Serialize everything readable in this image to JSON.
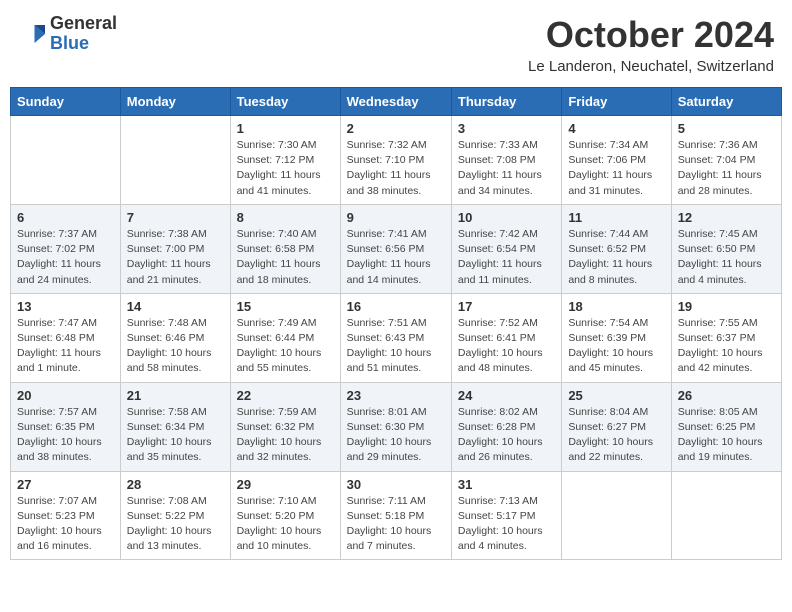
{
  "header": {
    "logo_general": "General",
    "logo_blue": "Blue",
    "month": "October 2024",
    "location": "Le Landeron, Neuchatel, Switzerland"
  },
  "days_of_week": [
    "Sunday",
    "Monday",
    "Tuesday",
    "Wednesday",
    "Thursday",
    "Friday",
    "Saturday"
  ],
  "weeks": [
    [
      {
        "day": "",
        "info": ""
      },
      {
        "day": "",
        "info": ""
      },
      {
        "day": "1",
        "info": "Sunrise: 7:30 AM\nSunset: 7:12 PM\nDaylight: 11 hours and 41 minutes."
      },
      {
        "day": "2",
        "info": "Sunrise: 7:32 AM\nSunset: 7:10 PM\nDaylight: 11 hours and 38 minutes."
      },
      {
        "day": "3",
        "info": "Sunrise: 7:33 AM\nSunset: 7:08 PM\nDaylight: 11 hours and 34 minutes."
      },
      {
        "day": "4",
        "info": "Sunrise: 7:34 AM\nSunset: 7:06 PM\nDaylight: 11 hours and 31 minutes."
      },
      {
        "day": "5",
        "info": "Sunrise: 7:36 AM\nSunset: 7:04 PM\nDaylight: 11 hours and 28 minutes."
      }
    ],
    [
      {
        "day": "6",
        "info": "Sunrise: 7:37 AM\nSunset: 7:02 PM\nDaylight: 11 hours and 24 minutes."
      },
      {
        "day": "7",
        "info": "Sunrise: 7:38 AM\nSunset: 7:00 PM\nDaylight: 11 hours and 21 minutes."
      },
      {
        "day": "8",
        "info": "Sunrise: 7:40 AM\nSunset: 6:58 PM\nDaylight: 11 hours and 18 minutes."
      },
      {
        "day": "9",
        "info": "Sunrise: 7:41 AM\nSunset: 6:56 PM\nDaylight: 11 hours and 14 minutes."
      },
      {
        "day": "10",
        "info": "Sunrise: 7:42 AM\nSunset: 6:54 PM\nDaylight: 11 hours and 11 minutes."
      },
      {
        "day": "11",
        "info": "Sunrise: 7:44 AM\nSunset: 6:52 PM\nDaylight: 11 hours and 8 minutes."
      },
      {
        "day": "12",
        "info": "Sunrise: 7:45 AM\nSunset: 6:50 PM\nDaylight: 11 hours and 4 minutes."
      }
    ],
    [
      {
        "day": "13",
        "info": "Sunrise: 7:47 AM\nSunset: 6:48 PM\nDaylight: 11 hours and 1 minute."
      },
      {
        "day": "14",
        "info": "Sunrise: 7:48 AM\nSunset: 6:46 PM\nDaylight: 10 hours and 58 minutes."
      },
      {
        "day": "15",
        "info": "Sunrise: 7:49 AM\nSunset: 6:44 PM\nDaylight: 10 hours and 55 minutes."
      },
      {
        "day": "16",
        "info": "Sunrise: 7:51 AM\nSunset: 6:43 PM\nDaylight: 10 hours and 51 minutes."
      },
      {
        "day": "17",
        "info": "Sunrise: 7:52 AM\nSunset: 6:41 PM\nDaylight: 10 hours and 48 minutes."
      },
      {
        "day": "18",
        "info": "Sunrise: 7:54 AM\nSunset: 6:39 PM\nDaylight: 10 hours and 45 minutes."
      },
      {
        "day": "19",
        "info": "Sunrise: 7:55 AM\nSunset: 6:37 PM\nDaylight: 10 hours and 42 minutes."
      }
    ],
    [
      {
        "day": "20",
        "info": "Sunrise: 7:57 AM\nSunset: 6:35 PM\nDaylight: 10 hours and 38 minutes."
      },
      {
        "day": "21",
        "info": "Sunrise: 7:58 AM\nSunset: 6:34 PM\nDaylight: 10 hours and 35 minutes."
      },
      {
        "day": "22",
        "info": "Sunrise: 7:59 AM\nSunset: 6:32 PM\nDaylight: 10 hours and 32 minutes."
      },
      {
        "day": "23",
        "info": "Sunrise: 8:01 AM\nSunset: 6:30 PM\nDaylight: 10 hours and 29 minutes."
      },
      {
        "day": "24",
        "info": "Sunrise: 8:02 AM\nSunset: 6:28 PM\nDaylight: 10 hours and 26 minutes."
      },
      {
        "day": "25",
        "info": "Sunrise: 8:04 AM\nSunset: 6:27 PM\nDaylight: 10 hours and 22 minutes."
      },
      {
        "day": "26",
        "info": "Sunrise: 8:05 AM\nSunset: 6:25 PM\nDaylight: 10 hours and 19 minutes."
      }
    ],
    [
      {
        "day": "27",
        "info": "Sunrise: 7:07 AM\nSunset: 5:23 PM\nDaylight: 10 hours and 16 minutes."
      },
      {
        "day": "28",
        "info": "Sunrise: 7:08 AM\nSunset: 5:22 PM\nDaylight: 10 hours and 13 minutes."
      },
      {
        "day": "29",
        "info": "Sunrise: 7:10 AM\nSunset: 5:20 PM\nDaylight: 10 hours and 10 minutes."
      },
      {
        "day": "30",
        "info": "Sunrise: 7:11 AM\nSunset: 5:18 PM\nDaylight: 10 hours and 7 minutes."
      },
      {
        "day": "31",
        "info": "Sunrise: 7:13 AM\nSunset: 5:17 PM\nDaylight: 10 hours and 4 minutes."
      },
      {
        "day": "",
        "info": ""
      },
      {
        "day": "",
        "info": ""
      }
    ]
  ]
}
